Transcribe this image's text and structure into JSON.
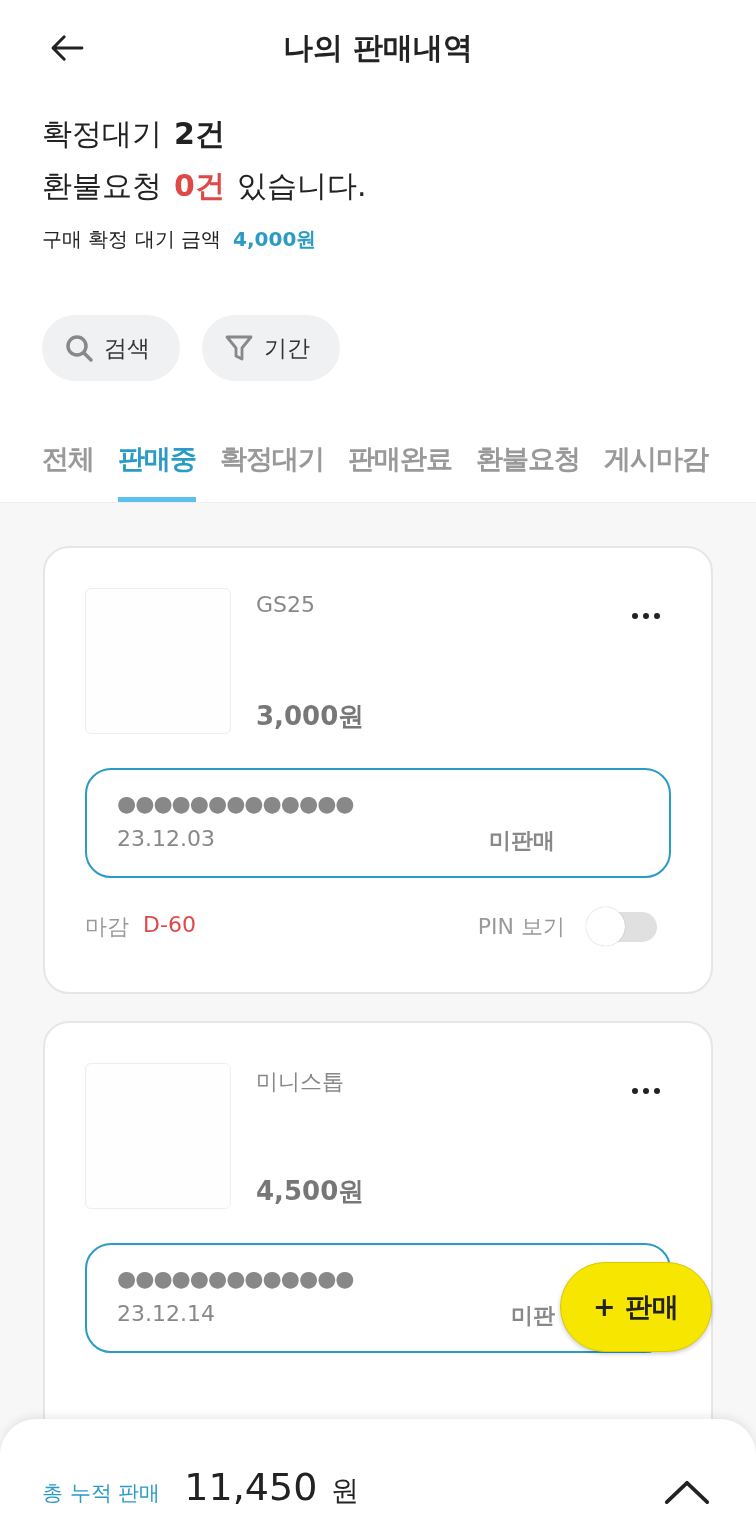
{
  "header": {
    "title": "나의 판매내역"
  },
  "summary": {
    "pending_label": "확정대기",
    "pending_count": "2건",
    "refund_label": "환불요청",
    "refund_count": "0건",
    "refund_suffix": "있습니다.",
    "amount_label": "구매 확정 대기 금액",
    "amount": "4,000원"
  },
  "filters": [
    {
      "kind": "search",
      "label": "검색"
    },
    {
      "kind": "period",
      "label": "기간"
    }
  ],
  "tabs": [
    {
      "label": "전체",
      "selected": false
    },
    {
      "label": "판매중",
      "selected": true
    },
    {
      "label": "확정대기",
      "selected": false
    },
    {
      "label": "판매완료",
      "selected": false
    },
    {
      "label": "환불요청",
      "selected": false
    },
    {
      "label": "게시마감",
      "selected": false
    }
  ],
  "items": [
    {
      "name": "GS25",
      "price": "3,000원",
      "pin": "●●●●●●●●●●●●●",
      "date": "23.12.03",
      "status": "미판매",
      "deadline_label": "마감",
      "deadline": "D-60",
      "pin_toggle_label": "PIN 보기",
      "pin_visible": false
    },
    {
      "name": "미니스톱",
      "price": "4,500원",
      "pin": "●●●●●●●●●●●●●",
      "date": "23.12.14",
      "status": "미판"
    }
  ],
  "fab": {
    "label": "+ 판매"
  },
  "footer": {
    "label": "총 누적 판매",
    "amount": "11,450",
    "unit": "원"
  }
}
